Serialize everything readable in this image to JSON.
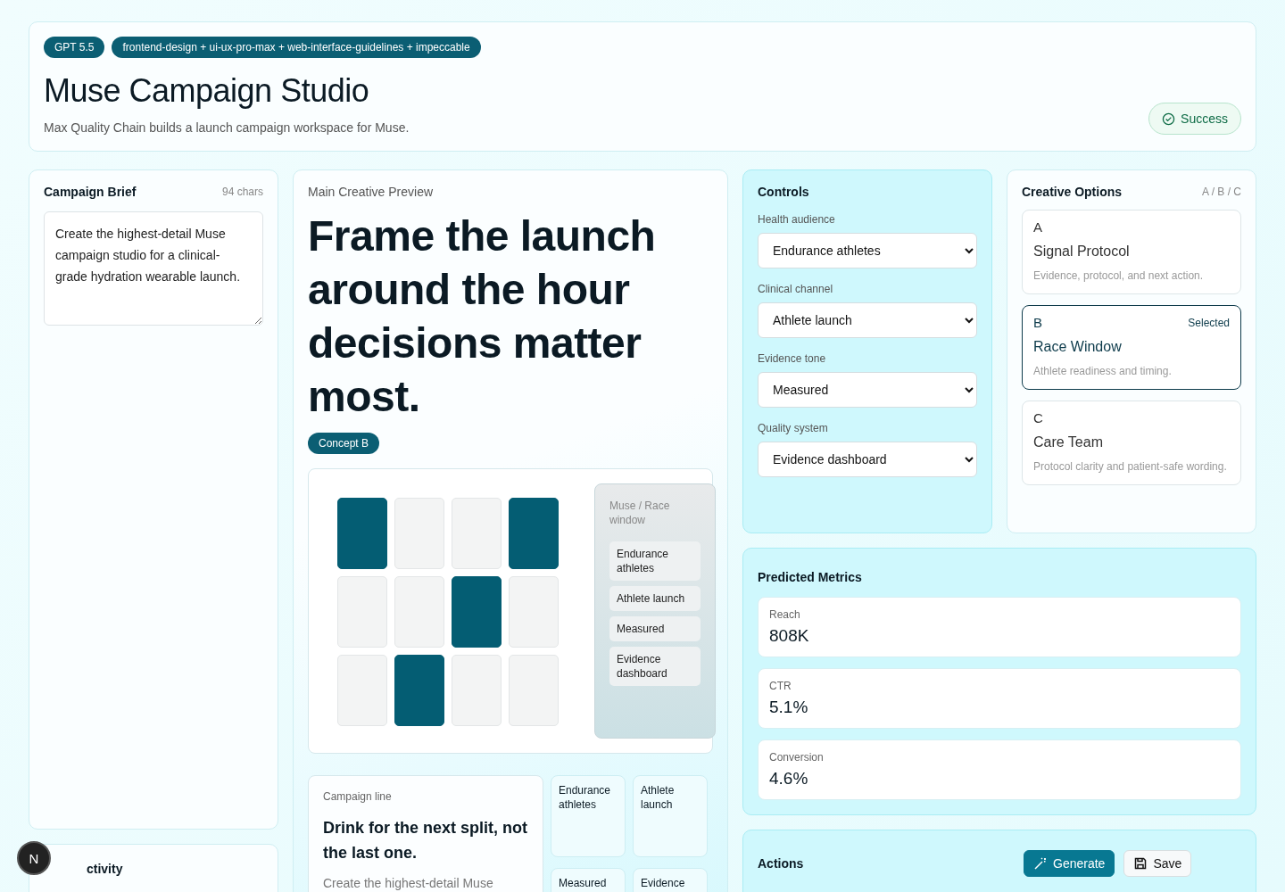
{
  "header": {
    "badges": [
      "GPT 5.5",
      "frontend-design + ui-ux-pro-max + web-interface-guidelines + impeccable"
    ],
    "title": "Muse Campaign Studio",
    "subtitle": "Max Quality Chain builds a launch campaign workspace for Muse.",
    "status": "Success"
  },
  "brief": {
    "title": "Campaign Brief",
    "count": "94 chars",
    "value": "Create the highest-detail Muse campaign studio for a clinical-grade hydration wearable launch."
  },
  "activity": {
    "title": "ctivity"
  },
  "preview": {
    "title": "Main Creative Preview",
    "headline": "Frame the launch around the hour decisions matter most.",
    "concept": "Concept B",
    "tiles": [
      {
        "on": true
      },
      {
        "on": false
      },
      {
        "on": false
      },
      {
        "on": true
      },
      {
        "on": false
      },
      {
        "on": false
      },
      {
        "on": true
      },
      {
        "on": false
      },
      {
        "on": false
      },
      {
        "on": true
      },
      {
        "on": false
      },
      {
        "on": false
      }
    ],
    "side": {
      "title": "Muse / Race window",
      "chips": [
        "Endurance athletes",
        "Athlete launch",
        "Measured",
        "Evidence dashboard"
      ]
    },
    "line": {
      "label": "Campaign line",
      "text": "Drink for the next split, not the last one.",
      "body": "Create the highest-detail Muse"
    },
    "mini_cards": [
      "Endurance athletes",
      "Athlete launch",
      "Measured",
      "Evidence"
    ]
  },
  "controls": {
    "title": "Controls",
    "fields": [
      {
        "label": "Health audience",
        "value": "Endurance athletes"
      },
      {
        "label": "Clinical channel",
        "value": "Athlete launch"
      },
      {
        "label": "Evidence tone",
        "value": "Measured"
      },
      {
        "label": "Quality system",
        "value": "Evidence dashboard"
      }
    ]
  },
  "options": {
    "title": "Creative Options",
    "hint": "A / B / C",
    "items": [
      {
        "letter": "A",
        "name": "Signal Protocol",
        "desc": "Evidence, protocol, and next action.",
        "selected": false
      },
      {
        "letter": "B",
        "name": "Race Window",
        "desc": "Athlete readiness and timing.",
        "selected": true,
        "tag": "Selected"
      },
      {
        "letter": "C",
        "name": "Care Team",
        "desc": "Protocol clarity and patient-safe wording.",
        "selected": false
      }
    ]
  },
  "metrics": {
    "title": "Predicted Metrics",
    "items": [
      {
        "label": "Reach",
        "value": "808K"
      },
      {
        "label": "CTR",
        "value": "5.1%"
      },
      {
        "label": "Conversion",
        "value": "4.6%"
      }
    ]
  },
  "actions": {
    "title": "Actions",
    "buttons": [
      {
        "kind": "primary",
        "label": "Generate"
      },
      {
        "kind": "secondary",
        "label": "Save"
      }
    ]
  },
  "dev_badge": "N"
}
